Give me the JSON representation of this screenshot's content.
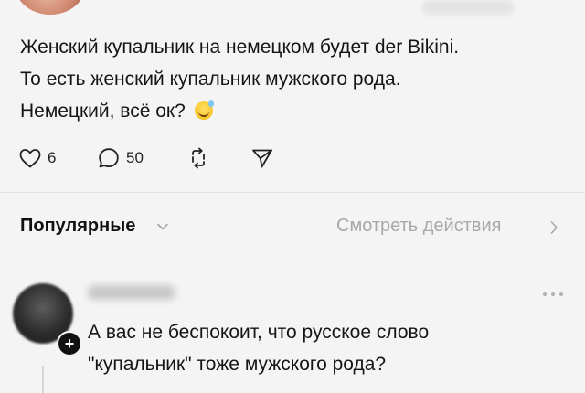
{
  "post": {
    "lines": [
      "Женский купальник на немецком будет der Bikini.",
      "То есть женский купальник мужского рода.",
      "Немецкий, всё ок?"
    ],
    "emoji": "sweat-smile-emoji",
    "likes": "6",
    "comments": "50"
  },
  "sort": {
    "label": "Популярные",
    "view_actions": "Смотреть действия"
  },
  "comment": {
    "lines": [
      "А вас не беспокоит, что русское слово",
      "\"купальник\" тоже мужского рода?"
    ]
  },
  "icons": {
    "like": "heart-icon",
    "comment": "comment-bubble-icon",
    "repost": "repost-icon",
    "share": "send-icon",
    "more": "more-dots-icon",
    "follow": "plus-icon"
  }
}
